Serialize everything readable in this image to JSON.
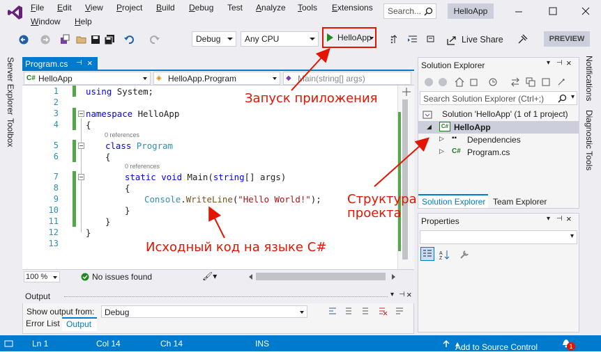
{
  "menu": {
    "items": [
      "File",
      "Edit",
      "View",
      "Project",
      "Build",
      "Debug",
      "Test",
      "Analyze",
      "Tools",
      "Extensions",
      "Window",
      "Help"
    ],
    "search_placeholder": "Search...",
    "app_title": "HelloApp"
  },
  "toolbar": {
    "configuration": "Debug",
    "platform": "Any CPU",
    "run_label": "HelloApp",
    "live_share": "Live Share",
    "preview": "PREVIEW"
  },
  "left_tabs": [
    "Server Explorer",
    "Toolbox"
  ],
  "right_tabs": [
    "Notifications",
    "Diagnostic Tools"
  ],
  "editor": {
    "tab_name": "Program.cs",
    "nav": {
      "project": "HelloApp",
      "class": "HelloApp.Program",
      "member": "Main(string[] args)"
    },
    "line_numbers": [
      "1",
      "2",
      "3",
      "4",
      "5",
      "6",
      "7",
      "8",
      "9",
      "10",
      "11",
      "12",
      "13"
    ],
    "references": "0 references",
    "code": {
      "l1_kw": "using",
      "l1_rest": " System;",
      "l3_kw": "namespace",
      "l3_rest": " HelloApp",
      "open_brace": "{",
      "close_brace": "}",
      "l5_kw": "class",
      "l5_type": "Program",
      "l7_static": "static",
      "l7_void": "void",
      "l7_main": " Main(",
      "l7_string": "string",
      "l7_args": "[] args)",
      "l9_console": "Console",
      "l9_dot": ".",
      "l9_method": "WriteLine",
      "l9_open": "(",
      "l9_str": "\"Hello World!\"",
      "l9_close": ");"
    },
    "zoom": "100 %",
    "issues": "No issues found"
  },
  "output": {
    "title": "Output",
    "show_from_label": "Show output from:",
    "source": "Debug",
    "tabs": [
      "Error List",
      "Output"
    ]
  },
  "solution_explorer": {
    "title": "Solution Explorer",
    "search_placeholder": "Search Solution Explorer (Ctrl+;)",
    "solution": "Solution 'HelloApp' (1 of 1 project)",
    "project": "HelloApp",
    "dependencies": "Dependencies",
    "file": "Program.cs",
    "tabs": [
      "Solution Explorer",
      "Team Explorer"
    ]
  },
  "properties": {
    "title": "Properties"
  },
  "status": {
    "line": "Ln 1",
    "col": "Col 14",
    "ch": "Ch 14",
    "ins": "INS",
    "source_control": "Add to Source Control",
    "notif_count": "1"
  },
  "annotations": {
    "run": "Запуск приложения",
    "structure_1": "Структура",
    "structure_2": "проекта",
    "code": "Исходный код на языке C#"
  },
  "colors": {
    "accent": "#007acc",
    "annotation": "#e51400",
    "change_bar": "#57a64a",
    "keyword": "#0000ff",
    "type": "#2b91af",
    "string": "#a31515"
  }
}
